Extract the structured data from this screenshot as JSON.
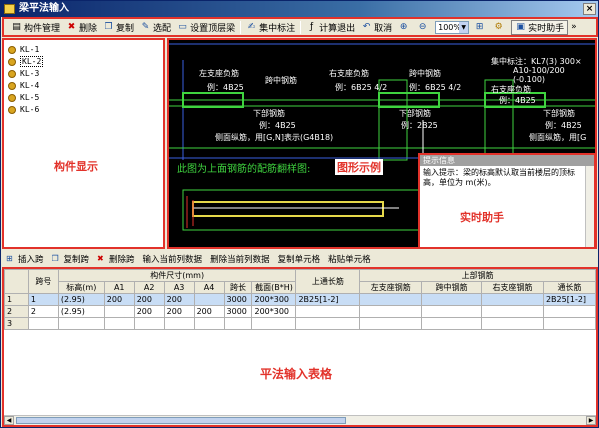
{
  "window": {
    "title": "梁平法输入",
    "close": "×"
  },
  "toolbar": {
    "items": [
      {
        "label": "构件管理",
        "icon": "▤"
      },
      {
        "label": "删除",
        "icon": "✖"
      },
      {
        "label": "复制",
        "icon": "❐"
      },
      {
        "label": "选配",
        "icon": "✎"
      },
      {
        "label": "设置顶层梁",
        "icon": "▭"
      },
      {
        "label": "集中标注",
        "icon": "✍"
      },
      {
        "label": "计算退出",
        "icon": "ƒ"
      },
      {
        "label": "取消",
        "icon": "↶"
      }
    ],
    "zoom": "100%",
    "assistant_label": "实时助手",
    "more": "»"
  },
  "tree": {
    "items": [
      "KL-1",
      "KL-2",
      "KL-3",
      "KL-4",
      "KL-5",
      "KL-6"
    ],
    "selected_index": 1,
    "caption": "构件显示"
  },
  "canvas": {
    "left_support": "左支座负筋",
    "left_support_eg": "例：4B25",
    "span_mid": "跨中钢筋",
    "right_support": "右支座负筋",
    "right_support_eg": "例：6B25 4/2",
    "span_mid2": "跨中钢筋",
    "span_mid2_eg": "例：6B25 4/2",
    "centralized": "集中标注：KL7(3) 300×",
    "centralized_2": "A10-100/200",
    "centralized_3": "(-0.100)",
    "right_support2": "右支座负筋",
    "right_support2_eg": "例：4B25",
    "bottom_bar": "下部钢筋",
    "bottom_bar_eg": "例：4B25",
    "side_bar": "侧面纵筋，用[G,N]表示(G4B18)",
    "bottom_bar2": "下部钢筋",
    "bottom_bar2_eg": "例：2B25",
    "bottom_bar3": "下部钢筋",
    "bottom_bar3_eg": "例：4B25",
    "side_bar2": "侧面纵筋，用[G",
    "note": "此图为上面钢筋的配筋翻样图:",
    "sample": "图形示例"
  },
  "tip": {
    "header": "提示信息",
    "body": "输入提示：梁的标高默认取当前楼层的顶标高，单位为 m(米)。",
    "caption": "实时助手"
  },
  "table_toolbar": [
    {
      "label": "插入跨",
      "icon": "⊞"
    },
    {
      "label": "复制跨",
      "icon": "❐"
    },
    {
      "label": "删除跨",
      "icon": "✖"
    },
    {
      "label": "输入当前列数据",
      "icon": ""
    },
    {
      "label": "删除当前列数据",
      "icon": ""
    },
    {
      "label": "复制单元格",
      "icon": ""
    },
    {
      "label": "粘贴单元格",
      "icon": ""
    }
  ],
  "grid": {
    "header_top": [
      "跨号",
      "构件尺寸(mm)",
      "上通长筋",
      "上部钢筋"
    ],
    "header_sub": [
      "标高(m)",
      "A1",
      "A2",
      "A3",
      "A4",
      "跨长",
      "截面(B*H)",
      "左支座钢筋",
      "跨中钢筋",
      "右支座钢筋",
      "通长筋"
    ],
    "rows": [
      {
        "idx": "1",
        "span": "1",
        "elev": "(2.95)",
        "a1": "200",
        "a2": "200",
        "a3": "200",
        "a4": "",
        "len": "3000",
        "section": "200*300",
        "top_through": "2B25[1-2]",
        "left": "",
        "mid": "",
        "right": "",
        "through": "2B25[1-2]"
      },
      {
        "idx": "2",
        "span": "2",
        "elev": "(2.95)",
        "a1": "",
        "a2": "200",
        "a3": "200",
        "a4": "200",
        "len": "3000",
        "section": "200*300",
        "top_through": "",
        "left": "",
        "mid": "",
        "right": "",
        "through": ""
      },
      {
        "idx": "3",
        "span": "",
        "elev": "",
        "a1": "",
        "a2": "",
        "a3": "",
        "a4": "",
        "len": "",
        "section": "",
        "top_through": "",
        "left": "",
        "mid": "",
        "right": "",
        "through": ""
      }
    ],
    "caption": "平法输入表格"
  }
}
